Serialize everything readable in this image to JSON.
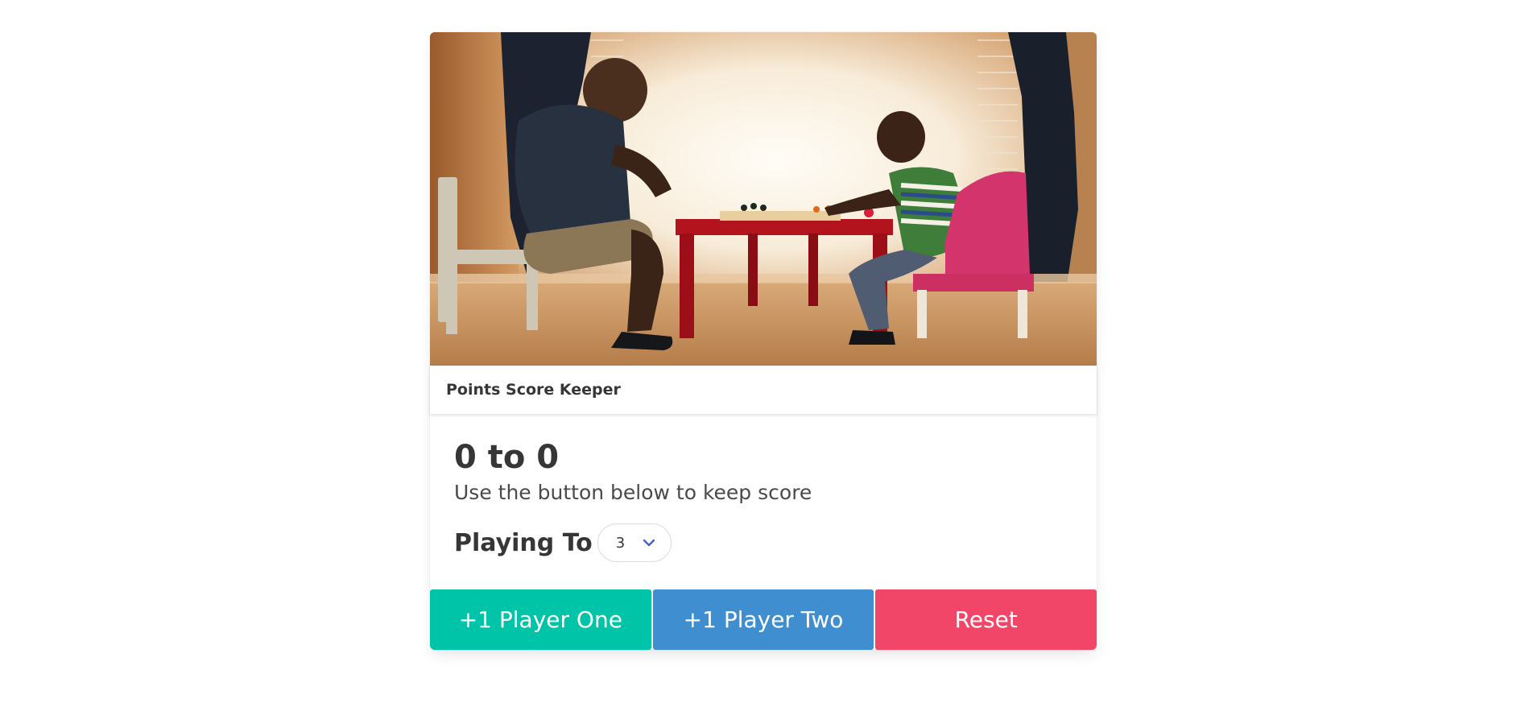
{
  "header": {
    "title": "Points Score Keeper"
  },
  "image": {
    "alt": "Photo of an adult and a child playing a board game at a red table"
  },
  "score": {
    "player_one": 0,
    "player_two": 0,
    "separator": "to",
    "display": "0 to 0"
  },
  "instructions": "Use the button below to keep score",
  "playing_to": {
    "label": "Playing To",
    "selected": "3"
  },
  "buttons": {
    "player_one": "+1 Player One",
    "player_two": "+1 Player Two",
    "reset": "Reset"
  },
  "colors": {
    "player_one": "#00c4a7",
    "player_two": "#3e8ed0",
    "reset": "#f14668",
    "chevron": "#485fc7"
  }
}
